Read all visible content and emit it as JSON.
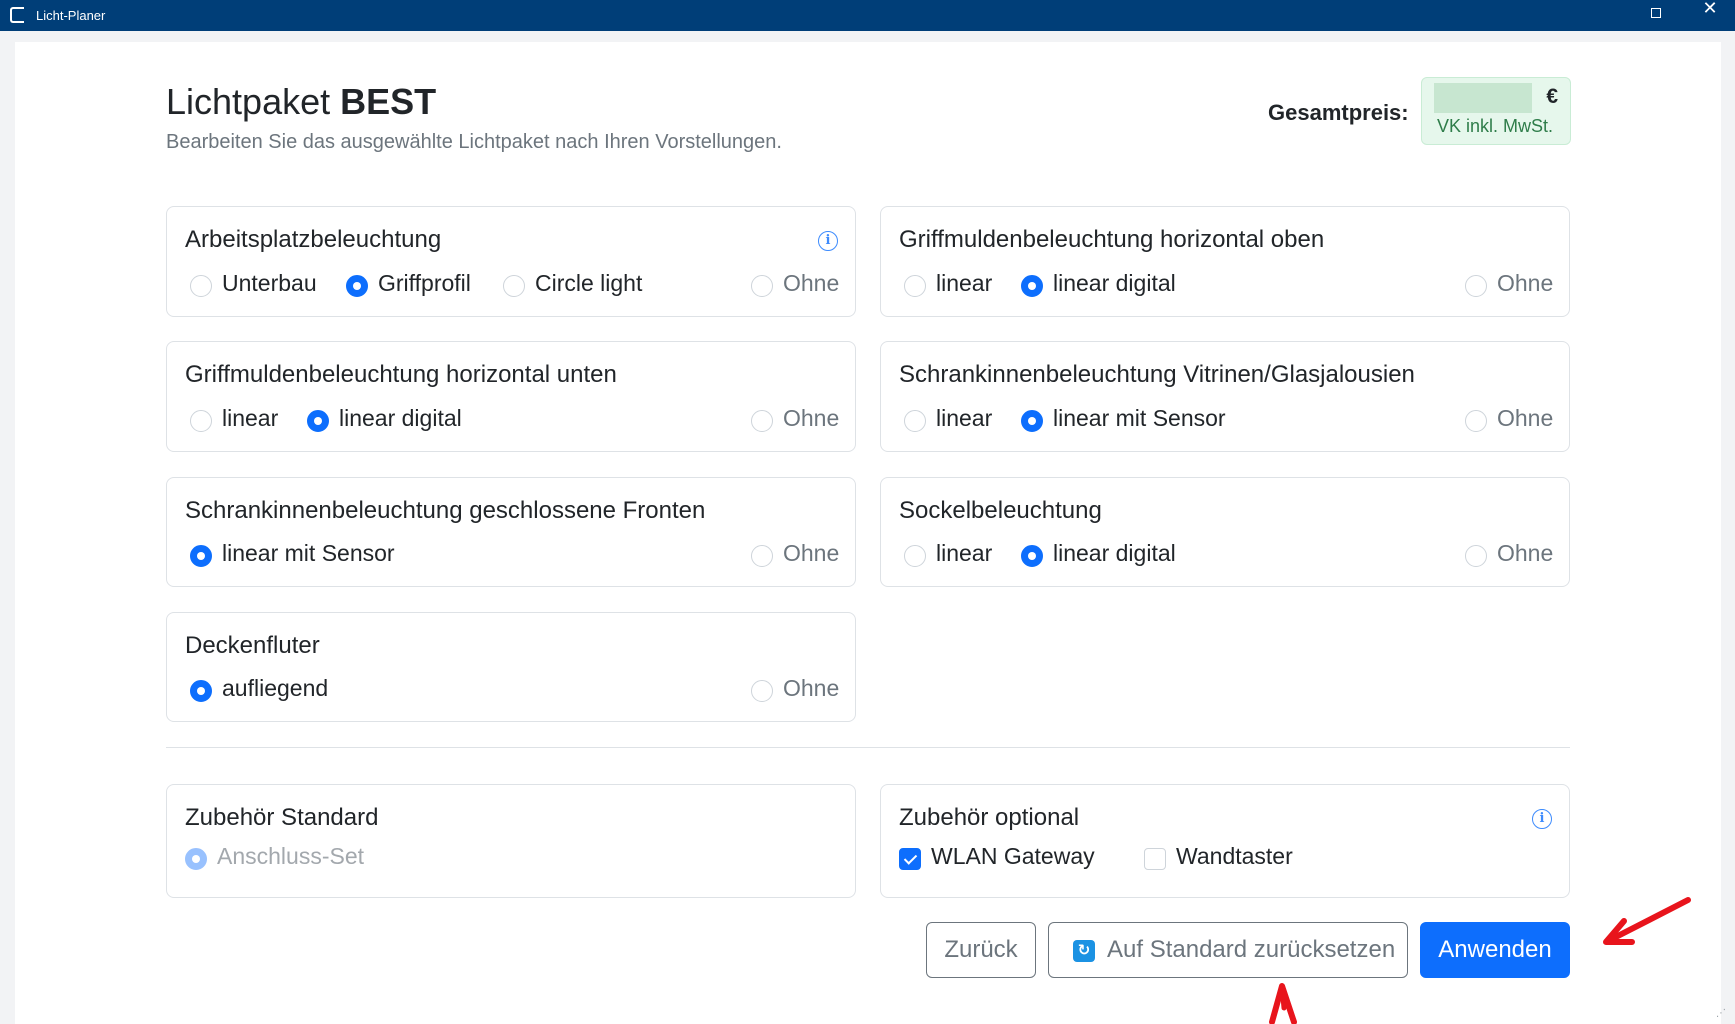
{
  "window": {
    "title": "Licht-Planer",
    "close_glyph": "✕"
  },
  "header": {
    "title_prefix": "Lichtpaket",
    "title_bold": "BEST",
    "subtitle": "Bearbeiten Sie das ausgewählte Lichtpaket nach Ihren Vorstellungen.",
    "price_label": "Gesamtpreis:",
    "price_value": "€",
    "price_note": "VK inkl. MwSt."
  },
  "cards": {
    "arbeitsplatz": {
      "title": "Arbeitsplatzbeleuchtung",
      "has_info": true,
      "options": [
        "Unterbau",
        "Griffprofil",
        "Circle light"
      ],
      "selected": "Griffprofil",
      "none_label": "Ohne"
    },
    "griff_oben": {
      "title": "Griffmuldenbeleuchtung horizontal oben",
      "options": [
        "linear",
        "linear digital"
      ],
      "selected": "linear digital",
      "none_label": "Ohne"
    },
    "griff_unten": {
      "title": "Griffmuldenbeleuchtung horizontal unten",
      "options": [
        "linear",
        "linear digital"
      ],
      "selected": "linear digital",
      "none_label": "Ohne"
    },
    "vitrinen": {
      "title": "Schrankinnenbeleuchtung Vitrinen/Glasjalousien",
      "options": [
        "linear",
        "linear mit Sensor"
      ],
      "selected": "linear mit Sensor",
      "none_label": "Ohne"
    },
    "geschlossen": {
      "title": "Schrankinnenbeleuchtung geschlossene Fronten",
      "options": [
        "linear mit Sensor"
      ],
      "selected": "linear mit Sensor",
      "none_label": "Ohne"
    },
    "sockel": {
      "title": "Sockelbeleuchtung",
      "options": [
        "linear",
        "linear digital"
      ],
      "selected": "linear digital",
      "none_label": "Ohne"
    },
    "decken": {
      "title": "Deckenfluter",
      "options": [
        "aufliegend"
      ],
      "selected": "aufliegend",
      "none_label": "Ohne"
    },
    "zub_standard": {
      "title": "Zubehör Standard",
      "options": [
        "Anschluss-Set"
      ],
      "selected": "Anschluss-Set",
      "disabled": true
    },
    "zub_optional": {
      "title": "Zubehör optional",
      "has_info": true,
      "checkboxes": [
        {
          "label": "WLAN Gateway",
          "checked": true
        },
        {
          "label": "Wandtaster",
          "checked": false
        }
      ]
    }
  },
  "buttons": {
    "back": "Zurück",
    "reset": "Auf Standard zurücksetzen",
    "apply": "Anwenden"
  },
  "colors": {
    "titlebar": "#003e78",
    "primary": "#0d6efd",
    "price_bg": "#e6f7ec",
    "annotation": "#e8141c"
  },
  "icons": {
    "info": "info-icon",
    "refresh": "refresh-icon",
    "check": "checkmark-icon"
  }
}
